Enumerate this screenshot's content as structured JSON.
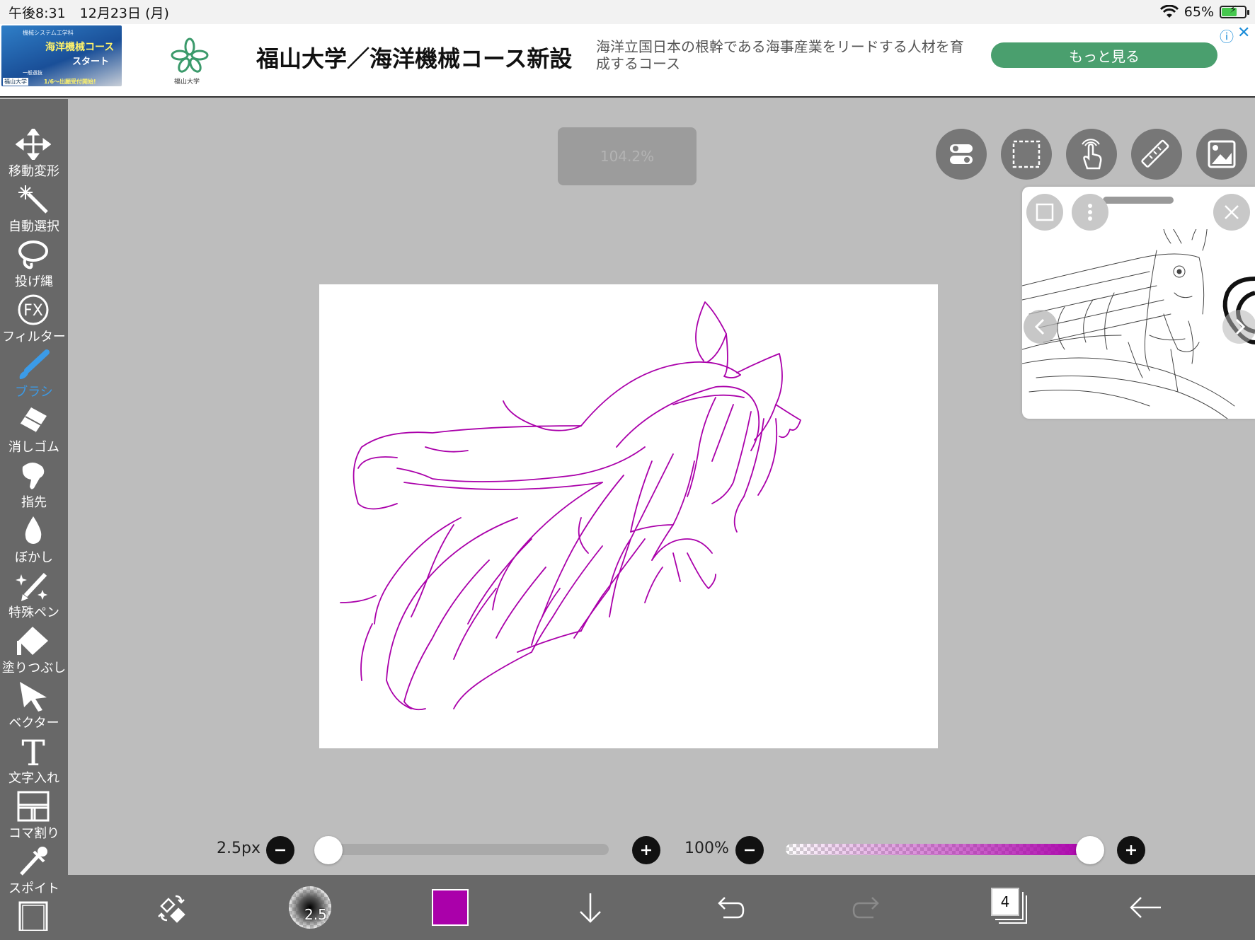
{
  "status_bar": {
    "time": "午後8:31",
    "date": "12月23日 (月)",
    "battery_percent": "65%",
    "battery_level": 0.65
  },
  "ad": {
    "thumb_line1": "機械システム工学科",
    "thumb_line2": "海洋機械コース",
    "thumb_line3": "スタート",
    "thumb_line4": "一般選抜",
    "thumb_line5": "1/6〜出願受付開始!",
    "thumb_brand": "福山大学",
    "logo_text": "福山大学",
    "title": "福山大学／海洋機械コース新設",
    "description": "海洋立国日本の根幹である海事産業をリードする人材を育成するコース",
    "cta": "もっと見る",
    "info_glyph": "ⓘ",
    "close_glyph": "✕"
  },
  "tools": [
    {
      "id": "move",
      "label": "移動変形",
      "icon": "move-icon"
    },
    {
      "id": "magic-wand",
      "label": "自動選択",
      "icon": "magic-wand-icon"
    },
    {
      "id": "lasso",
      "label": "投げ縄",
      "icon": "lasso-icon"
    },
    {
      "id": "filter",
      "label": "フィルター",
      "icon": "fx-icon",
      "icon_text": "FX"
    },
    {
      "id": "brush",
      "label": "ブラシ",
      "icon": "brush-icon",
      "active": true
    },
    {
      "id": "eraser",
      "label": "消しゴム",
      "icon": "eraser-icon"
    },
    {
      "id": "finger",
      "label": "指先",
      "icon": "finger-icon"
    },
    {
      "id": "blur",
      "label": "ぼかし",
      "icon": "blur-drop-icon"
    },
    {
      "id": "special-pen",
      "label": "特殊ペン",
      "icon": "sparkle-pen-icon"
    },
    {
      "id": "fill",
      "label": "塗りつぶし",
      "icon": "fill-icon"
    },
    {
      "id": "vector",
      "label": "ベクター",
      "icon": "cursor-arrow-icon"
    },
    {
      "id": "text",
      "label": "文字入れ",
      "icon": "text-icon",
      "icon_text": "T"
    },
    {
      "id": "frame",
      "label": "コマ割り",
      "icon": "frame-divider-icon"
    },
    {
      "id": "eyedropper",
      "label": "スポイト",
      "icon": "eyedropper-icon"
    }
  ],
  "zoom_level": "104.2%",
  "top_buttons": [
    "toggle-icon",
    "selection-rect-icon",
    "touch-hand-icon",
    "ruler-icon",
    "image-icon"
  ],
  "reference_panel": {
    "buttons": [
      "square-icon",
      "more-vertical-icon",
      "close-icon",
      "chevron-left-icon",
      "chevron-right-icon"
    ]
  },
  "brush_size": {
    "label": "2.5px",
    "value": 2.5,
    "fraction": 0.0
  },
  "opacity": {
    "label": "100%",
    "value": 100,
    "fraction": 1.0
  },
  "bottom_bar": {
    "brush_size_text": "2.5",
    "current_color": "#aa00aa",
    "layer_count": "4"
  },
  "colors": {
    "toolbar_bg": "#686868",
    "workspace_bg": "#bdbdbd",
    "accent_blue": "#3b9be8",
    "stroke_color": "#aa00aa",
    "ad_cta_green": "#4a9f6e"
  }
}
